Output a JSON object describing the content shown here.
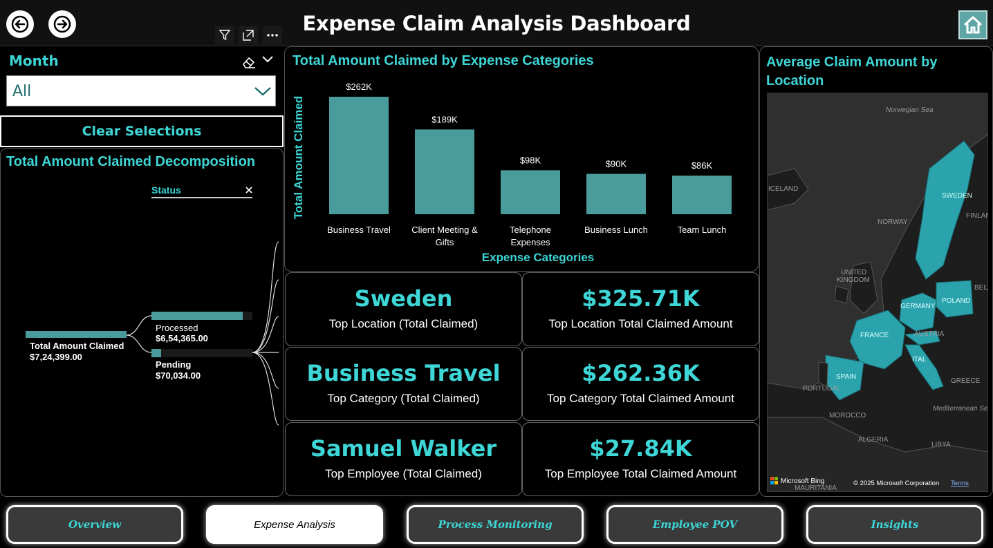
{
  "header": {
    "title": "Expense Claim Analysis Dashboard"
  },
  "slicer": {
    "label": "Month",
    "value": "All"
  },
  "clear_button": "Clear Selections",
  "decomposition": {
    "title": "Total Amount Claimed Decomposition",
    "level_label": "Status",
    "root": {
      "label": "Total Amount Claimed",
      "value": "$7,24,399.00"
    },
    "nodes": [
      {
        "label": "Processed",
        "value": "$6,54,365.00",
        "fraction": 0.903
      },
      {
        "label": "Pending",
        "value": "$70,034.00",
        "fraction": 0.097
      }
    ]
  },
  "chart_data": {
    "type": "bar",
    "title": "Total Amount Claimed by Expense Categories",
    "xlabel": "Expense Categories",
    "ylabel": "Total Amount Claimed",
    "categories": [
      "Business Travel",
      "Client Meeting & Gifts",
      "Telephone Expenses",
      "Business Lunch",
      "Team Lunch"
    ],
    "category_lines": [
      [
        "Business Travel"
      ],
      [
        "Client Meeting &",
        "Gifts"
      ],
      [
        "Telephone",
        "Expenses"
      ],
      [
        "Business Lunch"
      ],
      [
        "Team Lunch"
      ]
    ],
    "values": [
      262,
      189,
      98,
      90,
      86
    ],
    "data_labels": [
      "$262K",
      "$189K",
      "$98K",
      "$90K",
      "$86K"
    ],
    "ylim": [
      0,
      262
    ],
    "grid": false,
    "color": "#4a9c9c"
  },
  "kpis": [
    {
      "value": "Sweden",
      "label": "Top Location (Total Claimed)"
    },
    {
      "value": "$325.71K",
      "label": "Top Location Total Claimed Amount"
    },
    {
      "value": "Business Travel",
      "label": "Top Category (Total Claimed)"
    },
    {
      "value": "$262.36K",
      "label": "Top Category Total Claimed Amount"
    },
    {
      "value": "Samuel Walker",
      "label": "Top Employee (Total Claimed)"
    },
    {
      "value": "$27.84K",
      "label": "Top Employee Total Claimed Amount"
    }
  ],
  "map": {
    "title_line1": "Average Claim Amount by",
    "title_line2": "Location",
    "labels": {
      "norwegian_sea": "Norwegian Sea",
      "iceland": "ICELAND",
      "sweden": "SWEDEN",
      "finland": "FINLAN",
      "norway": "NORWAY",
      "uk1": "UNITED",
      "uk2": "KINGDOM",
      "belarus": "BELA",
      "poland": "POLAND",
      "germany": "GERMANY",
      "france": "FRANCE",
      "austria": "AUSTRIA",
      "italy": "ITAL",
      "spain": "SPAIN",
      "portugal": "PORTUGAL",
      "greece": "GREECE",
      "med": "Mediterranean Sea",
      "morocco": "MOROCCO",
      "algeria": "ALGERIA",
      "libya": "LIBYA",
      "mauritania": "MAURITANIA"
    },
    "bing": "Microsoft Bing",
    "copyright": "© 2025 Microsoft Corporation",
    "terms": "Terms",
    "highlight_color": "#2aa3ad"
  },
  "nav_tabs": [
    {
      "label": "Overview",
      "active": false
    },
    {
      "label": "Expense Analysis",
      "active": true
    },
    {
      "label": "Process Monitoring",
      "active": false
    },
    {
      "label": "Employee POV",
      "active": false
    },
    {
      "label": "Insights",
      "active": false
    }
  ],
  "icons": [
    "back-arrow-icon",
    "forward-arrow-icon",
    "filter-icon",
    "focus-mode-icon",
    "more-options-icon",
    "home-icon",
    "eraser-icon",
    "chevron-down-icon",
    "close-icon"
  ]
}
